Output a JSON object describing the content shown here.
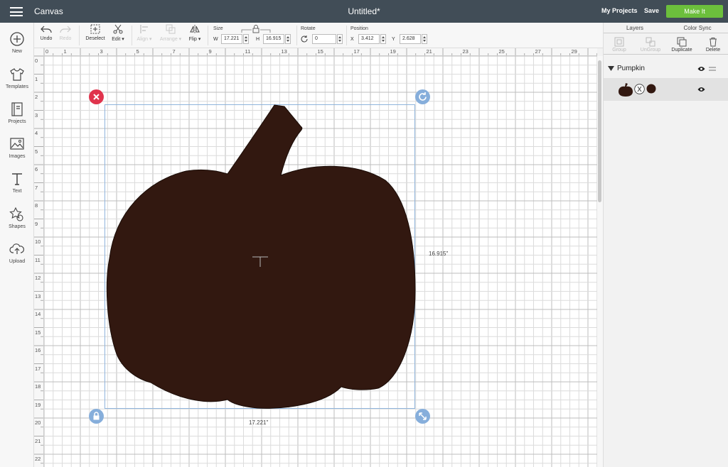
{
  "topbar": {
    "app_title": "Canvas",
    "doc_title": "Untitled*",
    "my_projects": "My Projects",
    "save": "Save",
    "make_it": "Make It"
  },
  "left_sidebar": {
    "items": [
      {
        "label": "New",
        "icon": "plus-circle-icon"
      },
      {
        "label": "Templates",
        "icon": "shirt-icon"
      },
      {
        "label": "Projects",
        "icon": "book-icon"
      },
      {
        "label": "Images",
        "icon": "image-icon"
      },
      {
        "label": "Text",
        "icon": "text-t-icon"
      },
      {
        "label": "Shapes",
        "icon": "shapes-icon"
      },
      {
        "label": "Upload",
        "icon": "cloud-upload-icon"
      }
    ]
  },
  "toolbar": {
    "undo": "Undo",
    "redo": "Redo",
    "deselect": "Deselect",
    "edit": "Edit",
    "align": "Align",
    "arrange": "Arrange",
    "flip": "Flip",
    "size_label": "Size",
    "w_label": "W",
    "w_value": "17.221",
    "h_label": "H",
    "h_value": "16.915",
    "rotate_label": "Rotate",
    "rotate_value": "0",
    "position_label": "Position",
    "x_label": "X",
    "x_value": "3.412",
    "y_label": "Y",
    "y_value": "2.628"
  },
  "ruler": {
    "top_ticks": [
      "0",
      "1",
      "3",
      "5",
      "7",
      "9",
      "11",
      "13",
      "15",
      "17",
      "19",
      "21",
      "23",
      "25",
      "27",
      "29"
    ],
    "left_ticks": [
      "0",
      "1",
      "2",
      "3",
      "4",
      "5",
      "6",
      "7",
      "8",
      "9",
      "10",
      "11",
      "12",
      "13",
      "14",
      "15",
      "16",
      "17",
      "18",
      "19",
      "20",
      "21",
      "22"
    ]
  },
  "canvas": {
    "width_dimension": "17.221\"",
    "height_dimension": "16.915\"",
    "shape_color": "#321810",
    "selection_color": "#8fb4dc",
    "delete_handle_color": "#e0344d",
    "handle_color": "#86aedb"
  },
  "right_panel": {
    "tabs": [
      "Layers",
      "Color Sync"
    ],
    "actions": [
      "Group",
      "UnGroup",
      "Duplicate",
      "Delete"
    ],
    "layer_group_name": "Pumpkin"
  }
}
